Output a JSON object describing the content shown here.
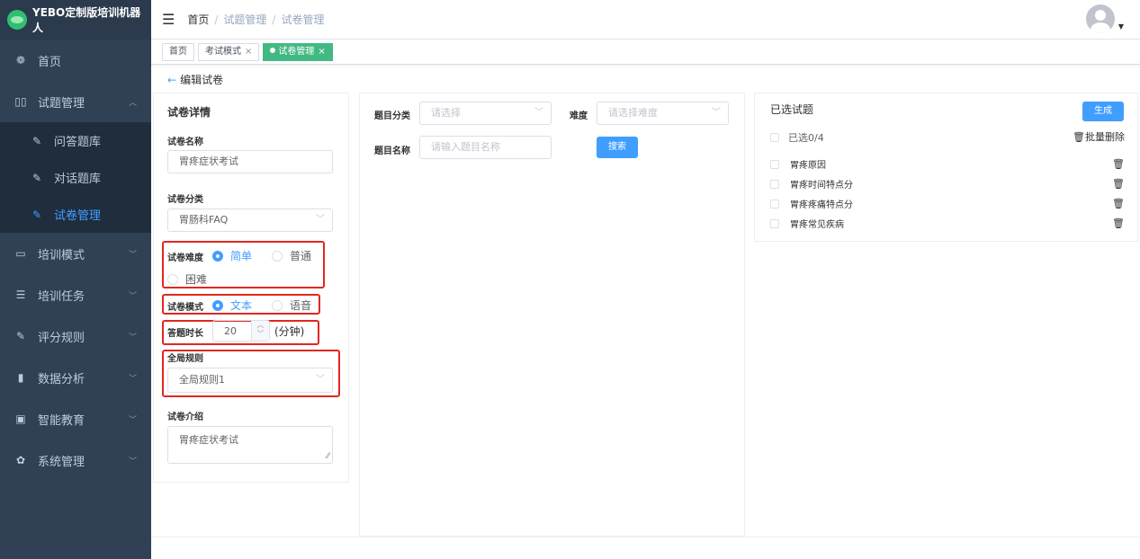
{
  "app": {
    "title": "YEBO定制版培训机器人"
  },
  "sidebar": {
    "items": [
      {
        "label": "首页",
        "icon": "dashboard-icon"
      },
      {
        "label": "试题管理",
        "icon": "book-icon",
        "expanded": true,
        "children": [
          {
            "label": "问答题库",
            "icon": "edit-icon"
          },
          {
            "label": "对话题库",
            "icon": "edit-icon"
          },
          {
            "label": "试卷管理",
            "icon": "edit-icon",
            "active": true
          }
        ]
      },
      {
        "label": "培训模式",
        "icon": "monitor-icon"
      },
      {
        "label": "培训任务",
        "icon": "list-icon"
      },
      {
        "label": "评分规则",
        "icon": "edit-icon"
      },
      {
        "label": "数据分析",
        "icon": "bar-chart-icon"
      },
      {
        "label": "智能教育",
        "icon": "screen-icon"
      },
      {
        "label": "系统管理",
        "icon": "gear-icon"
      }
    ]
  },
  "header": {
    "breadcrumb": [
      "首页",
      "试题管理",
      "试卷管理"
    ]
  },
  "tags": [
    {
      "label": "首页",
      "closable": false
    },
    {
      "label": "考试模式",
      "closable": true
    },
    {
      "label": "试卷管理",
      "closable": true,
      "active": true
    }
  ],
  "back": {
    "label": "编辑试卷"
  },
  "detail": {
    "title": "试卷详情",
    "name_label": "试卷名称",
    "name_value": "胃疼症状考试",
    "category_label": "试卷分类",
    "category_value": "胃肠科FAQ",
    "difficulty_label": "试卷难度",
    "difficulty_options": [
      "简单",
      "普通",
      "困难"
    ],
    "difficulty_selected": "简单",
    "mode_label": "试卷模式",
    "mode_options": [
      "文本",
      "语音"
    ],
    "mode_selected": "文本",
    "duration_label": "答题时长",
    "duration_value": "20",
    "duration_unit": "(分钟)",
    "rule_label": "全局规则",
    "rule_value": "全局规则1",
    "intro_label": "试卷介绍",
    "intro_value": "胃疼症状考试"
  },
  "search": {
    "category_label": "题目分类",
    "category_placeholder": "请选择",
    "difficulty_label": "难度",
    "difficulty_placeholder": "请选择难度",
    "name_label": "题目名称",
    "name_placeholder": "请输入题目名称",
    "search_button": "搜索"
  },
  "selected": {
    "title": "已选试题",
    "generate_button": "生成",
    "count_label": "已选0/4",
    "batch_delete": "批量删除",
    "items": [
      "胃疼原因",
      "胃疼时间特点分",
      "胃疼疼痛特点分",
      "胃疼常见疾病"
    ]
  },
  "colors": {
    "primary": "#409eff",
    "sidebar": "#304156",
    "tag_active": "#42b983",
    "highlight": "#e0281f"
  }
}
